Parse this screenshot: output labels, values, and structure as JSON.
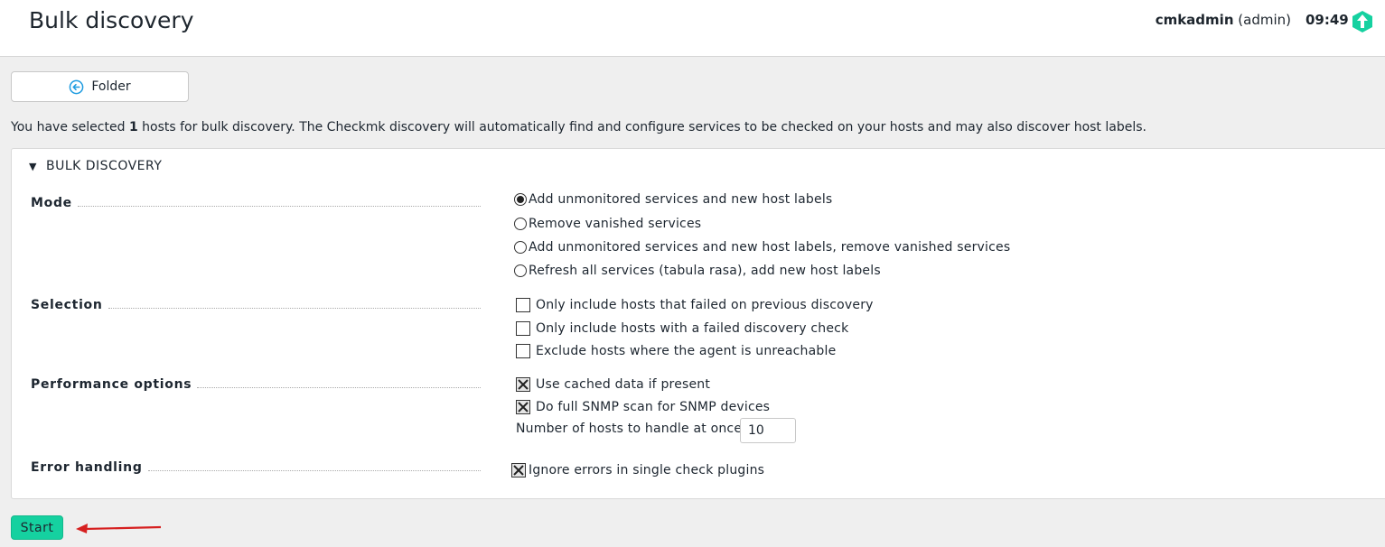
{
  "header": {
    "title": "Bulk discovery",
    "user": "cmkadmin",
    "role": "(admin)",
    "time": "09:49",
    "update_icon": "up-arrow-icon",
    "accent": "#15d1a0"
  },
  "toolbar": {
    "folder_label": "Folder",
    "folder_icon": "back-arrow-circle-icon"
  },
  "intro": {
    "prefix": "You have selected ",
    "count": "1",
    "suffix": " hosts for bulk discovery. The Checkmk discovery will automatically find and configure services to be checked on your hosts and may also discover host labels."
  },
  "section": {
    "title": "BULK DISCOVERY",
    "mode": {
      "label": "Mode",
      "options": [
        "Add unmonitored services and new host labels",
        "Remove vanished services",
        "Add unmonitored services and new host labels, remove vanished services",
        "Refresh all services (tabula rasa), add new host labels"
      ],
      "selected_index": 0
    },
    "selection": {
      "label": "Selection",
      "options": [
        {
          "label": "Only include hosts that failed on previous discovery",
          "checked": false
        },
        {
          "label": "Only include hosts with a failed discovery check",
          "checked": false
        },
        {
          "label": "Exclude hosts where the agent is unreachable",
          "checked": false
        }
      ]
    },
    "performance": {
      "label": "Performance options",
      "options": [
        {
          "label": "Use cached data if present",
          "checked": true
        },
        {
          "label": "Do full SNMP scan for SNMP devices",
          "checked": true
        }
      ],
      "hosts_label": "Number of hosts to handle at once",
      "hosts_value": "10"
    },
    "errors": {
      "label": "Error handling",
      "options": [
        {
          "label": "Ignore errors in single check plugins",
          "checked": true
        }
      ]
    }
  },
  "actions": {
    "start_label": "Start"
  }
}
